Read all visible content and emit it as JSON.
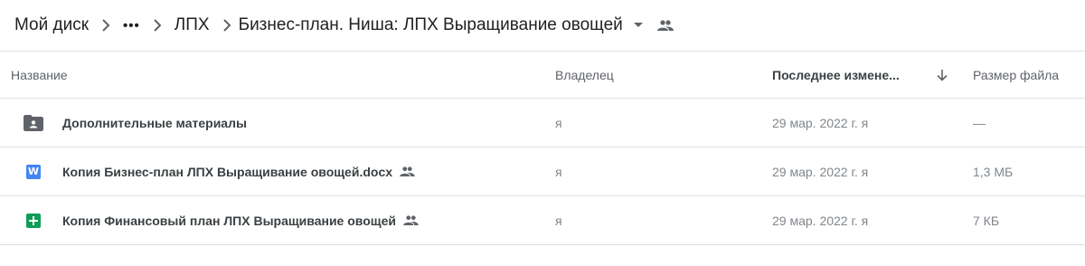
{
  "breadcrumb": {
    "root": "Мой диск",
    "more": "•••",
    "parent": "ЛПХ",
    "current": "Бизнес-план. Ниша: ЛПХ Выращивание овощей"
  },
  "columns": {
    "name": "Название",
    "owner": "Владелец",
    "modified": "Последнее измене...",
    "size": "Размер файла"
  },
  "files": [
    {
      "type": "folder-shared",
      "name": "Дополнительные материалы",
      "shared": false,
      "owner": "я",
      "modified": "29 мар. 2022 г. я",
      "size": "—"
    },
    {
      "type": "word-doc",
      "icon_letter": "W",
      "name": "Копия Бизнес-план ЛПХ Выращивание овощей.docx",
      "shared": true,
      "owner": "я",
      "modified": "29 мар. 2022 г. я",
      "size": "1,3 МБ"
    },
    {
      "type": "google-sheet",
      "name": "Копия Финансовый план ЛПХ Выращивание овощей",
      "shared": true,
      "owner": "я",
      "modified": "29 мар. 2022 г. я",
      "size": "7 КБ"
    }
  ],
  "colors": {
    "text": "#202124",
    "muted": "#80868b",
    "border": "#e0e0e0",
    "doc_blue": "#4285f4",
    "sheet_green": "#0f9d58",
    "folder_gray": "#5f6368"
  }
}
